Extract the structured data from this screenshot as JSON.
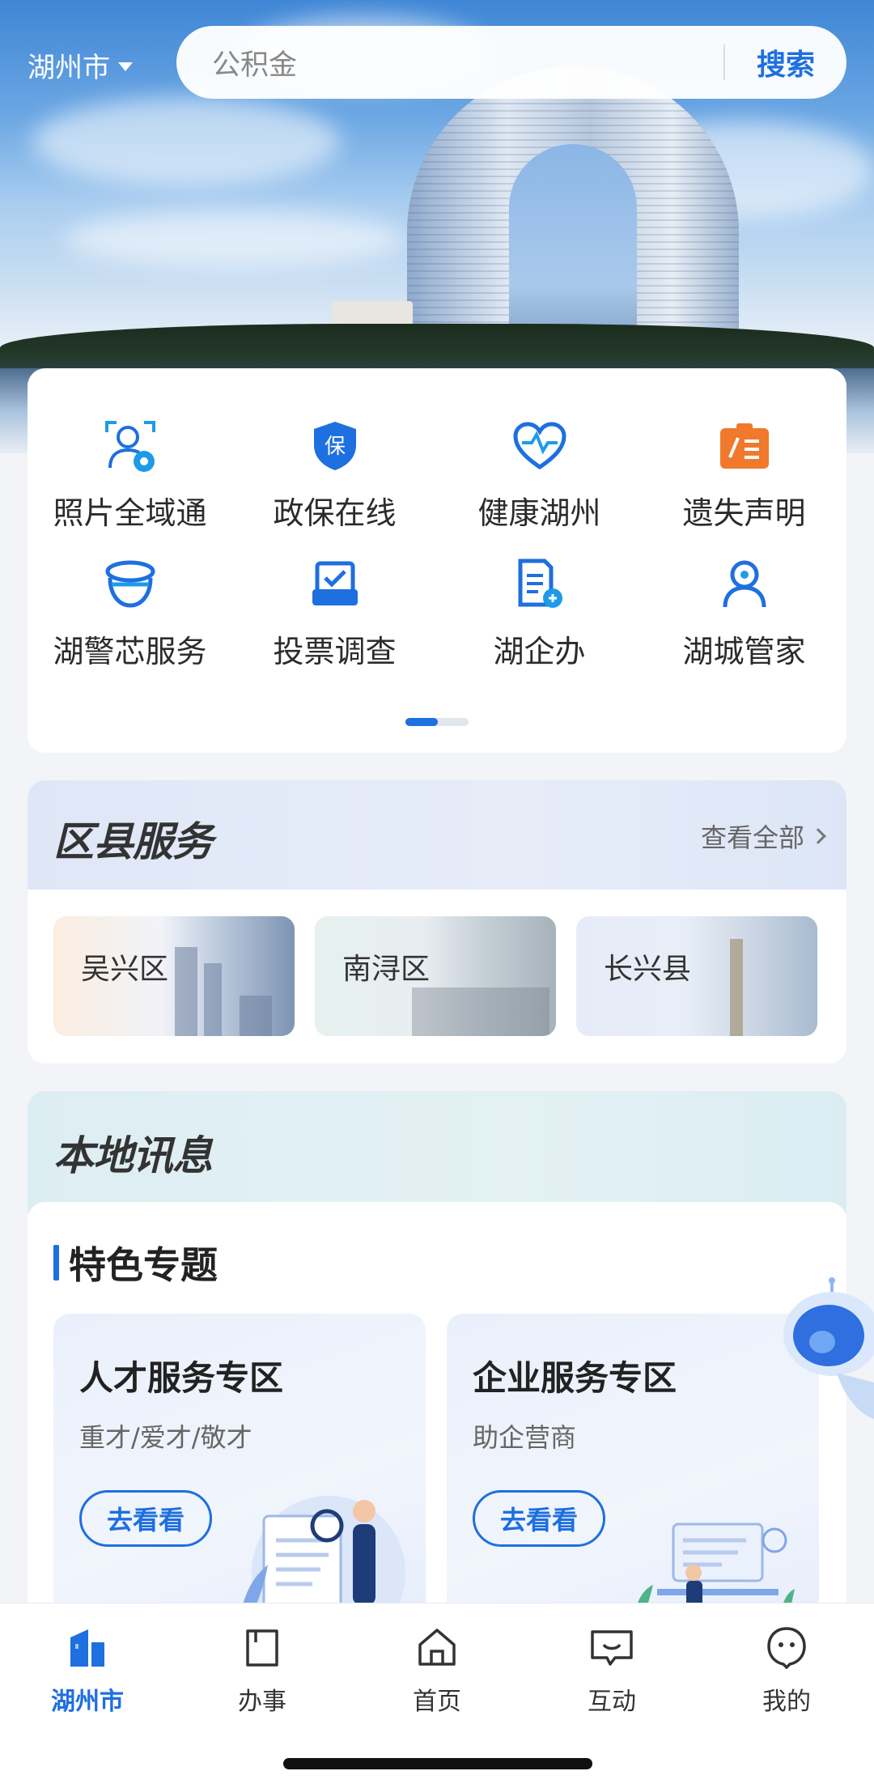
{
  "header": {
    "city": "湖州市",
    "search_placeholder": "公积金",
    "search_button": "搜索"
  },
  "quick_services": [
    {
      "label": "照片全域通",
      "icon": "face-id-icon",
      "color": "#1e8fe0"
    },
    {
      "label": "政保在线",
      "icon": "shield-icon",
      "color": "#1e6fe0"
    },
    {
      "label": "健康湖州",
      "icon": "heart-pulse-icon",
      "color": "#1e6fe0"
    },
    {
      "label": "遗失声明",
      "icon": "notice-icon",
      "color": "#f0792b"
    },
    {
      "label": "湖警芯服务",
      "icon": "police-cap-icon",
      "color": "#1e6fe0"
    },
    {
      "label": "投票调查",
      "icon": "ballot-box-icon",
      "color": "#1e6fe0"
    },
    {
      "label": "湖企办",
      "icon": "enterprise-doc-icon",
      "color": "#1e6fe0"
    },
    {
      "label": "湖城管家",
      "icon": "person-icon",
      "color": "#1e6fe0"
    }
  ],
  "pager": {
    "current": 1,
    "total": 2
  },
  "district": {
    "title": "区县服务",
    "view_all": "查看全部",
    "items": [
      "吴兴区",
      "南浔区",
      "长兴县"
    ]
  },
  "news": {
    "title": "本地讯息",
    "topic_title": "特色专题",
    "topics": [
      {
        "title": "人才服务专区",
        "subtitle": "重才/爱才/敬才",
        "button": "去看看"
      },
      {
        "title": "企业服务专区",
        "subtitle": "助企营商",
        "button": "去看看"
      }
    ]
  },
  "tabbar": [
    {
      "label": "湖州市",
      "icon": "city-building-icon",
      "active": true
    },
    {
      "label": "办事",
      "icon": "document-icon",
      "active": false
    },
    {
      "label": "首页",
      "icon": "home-icon",
      "active": false
    },
    {
      "label": "互动",
      "icon": "chat-icon",
      "active": false
    },
    {
      "label": "我的",
      "icon": "profile-icon",
      "active": false
    }
  ],
  "colors": {
    "accent": "#1e6fe0",
    "orange": "#f0792b"
  }
}
